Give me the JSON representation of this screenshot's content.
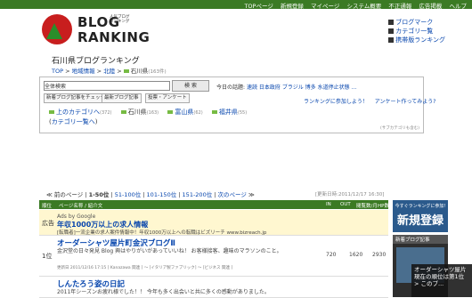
{
  "top_nav": [
    "TOPページ",
    "新規登録",
    "マイページ",
    "システム概要",
    "不正通報",
    "広告掲載",
    "ヘルプ"
  ],
  "logo": {
    "line1": "BLOG",
    "line2": "RANKING",
    "small": "人気ブログ ランキング"
  },
  "right_links": [
    "ブログマーク",
    "カテゴリ一覧",
    "携帯版ランキング"
  ],
  "page_title": "石川県ブログランキング",
  "breadcrumb": {
    "a": "TOP",
    "b": "地域情報",
    "c": "北陸",
    "current": "石川県",
    "count": "(163件)"
  },
  "search": {
    "placeholder": "全体検索",
    "button": "検 索"
  },
  "buttons": [
    "新着ブログ記事をチェック!",
    "最新ブログ記事",
    "投票・アンケート"
  ],
  "tags": {
    "label": "今日の話題:",
    "items": [
      "速読",
      "日本政府",
      "ブラジル",
      "博多",
      "水道停止状態",
      "..."
    ]
  },
  "links": [
    "ランキングに参加しよう！",
    "アンケート作ってみよう?"
  ],
  "categories": {
    "upper": "上のカテゴリへ",
    "upper_count": "(372)",
    "items": [
      {
        "name": "石川県",
        "count": "(163)"
      },
      {
        "name": "富山県",
        "count": "(62)"
      },
      {
        "name": "福井県",
        "count": "(55)"
      }
    ],
    "all": "カテゴリ一覧へ"
  },
  "note": "(サブカテゴリも含む)",
  "pager": {
    "prev": "前のページ",
    "current": "1-50位",
    "p2": "51-100位",
    "p3": "101-150位",
    "p4": "151-200位",
    "next": "次のページ"
  },
  "updated": "[更新日時:2011/12/17 16:30]",
  "table_header": [
    "順位",
    "ページ名称 / 紹介文",
    "IN",
    "OUT",
    "閲覧数/月",
    "HP数"
  ],
  "ad": {
    "label": "広告",
    "source": "Ads by Google",
    "title": "年収1000万以上の求人情報",
    "desc": "[転職者]一流企業の求人案件情報中！年収1000万以上への転職はビズリーチ www.bizreach.jp"
  },
  "rows": [
    {
      "rank": "1位",
      "title": "オーダーシャツ屋片町金沢ブログⅡ",
      "desc1": "金沢堂の日々発見 Blog 興はやりがいがあっていいね！ お客様接客、趣味のマラソンのこと。",
      "desc2": "",
      "meta": "更新日 2011/12/16 17:15 [ Kanazawa 関連 ] ～ [イタリア製ファブリック] ～ [ビジネス 関連 ]",
      "in": "720",
      "out": "1620",
      "views": "2930"
    },
    {
      "rank": "",
      "title": "しんたろう姿の日記",
      "desc1": "2011年シーズンお疲れ様でした！！ 今年も多く出会いと共に多くの感動がありました。",
      "in": "",
      "out": "",
      "views": ""
    }
  ],
  "sidebar": {
    "ad_small": "今すぐランキングに参加!",
    "ad_big": "新規登録",
    "box_title": "新着ブログ記事",
    "overlay_title": "オーダーシャツ屋片",
    "overlay_sub": "現在の順位は第1位",
    "overlay_link": "> このブ..."
  }
}
